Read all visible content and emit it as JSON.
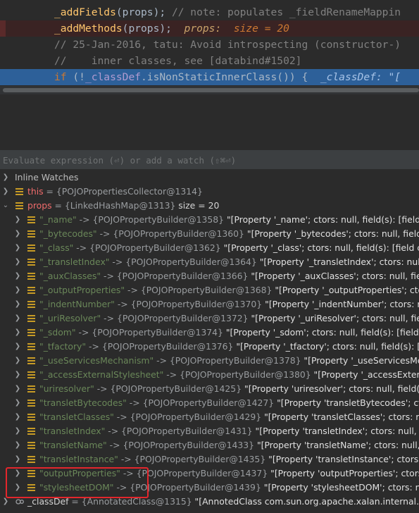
{
  "editor": {
    "lines": [
      {
        "kind": "normal",
        "parts": [
          {
            "cls": "c-method",
            "t": "_addFields"
          },
          {
            "cls": "c-text",
            "t": "(props); "
          },
          {
            "cls": "c-comment",
            "t": "// note: populates _fieldRenameMappin"
          }
        ]
      },
      {
        "kind": "bp",
        "parts": [
          {
            "cls": "c-method",
            "t": "_addMethods"
          },
          {
            "cls": "c-text",
            "t": "(props);  "
          },
          {
            "cls": "c-inline",
            "t": "props:  "
          },
          {
            "cls": "c-inline-v",
            "t": "size = 20"
          }
        ]
      },
      {
        "kind": "normal",
        "parts": [
          {
            "cls": "c-comment",
            "t": "// 25-Jan-2016, tatu: Avoid introspecting (constructor-)"
          }
        ]
      },
      {
        "kind": "normal",
        "parts": [
          {
            "cls": "c-comment",
            "t": "//    inner classes, see [databind#1502]"
          }
        ]
      },
      {
        "kind": "exec",
        "parts": [
          {
            "cls": "c-kw",
            "t": "if "
          },
          {
            "cls": "c-text",
            "t": "(!"
          },
          {
            "cls": "c-field",
            "t": "_classDef"
          },
          {
            "cls": "c-text",
            "t": ".isNonStaticInnerClass()) {  "
          },
          {
            "cls": "c-inline",
            "t": "_classDef: \"["
          }
        ]
      }
    ]
  },
  "eval": {
    "placeholder": "Evaluate expression (⏎) or add a watch (⇧⌘⏎)"
  },
  "tree": {
    "inline_watches": "Inline Watches",
    "this_row": {
      "name": "this",
      "eq": " = ",
      "value": "{POJOPropertiesCollector@1314}"
    },
    "props_row": {
      "name": "props",
      "eq": " = ",
      "value": "{LinkedHashMap@1313}",
      "size": "  size = 20"
    },
    "entries": [
      {
        "key": "\"_name\"",
        "ref": "{POJOPropertyBuilder@1358}",
        "val": "\"[Property '_name'; ctors: null, field(s): [field c"
      },
      {
        "key": "\"_bytecodes\"",
        "ref": "{POJOPropertyBuilder@1360}",
        "val": "\"[Property '_bytecodes'; ctors: null, field(s"
      },
      {
        "key": "\"_class\"",
        "ref": "{POJOPropertyBuilder@1362}",
        "val": "\"[Property '_class'; ctors: null, field(s): [field co"
      },
      {
        "key": "\"_transletIndex\"",
        "ref": "{POJOPropertyBuilder@1364}",
        "val": "\"[Property '_transletIndex'; ctors: null,"
      },
      {
        "key": "\"_auxClasses\"",
        "ref": "{POJOPropertyBuilder@1366}",
        "val": "\"[Property '_auxClasses'; ctors: null, fiel"
      },
      {
        "key": "\"_outputProperties\"",
        "ref": "{POJOPropertyBuilder@1368}",
        "val": "\"[Property '_outputProperties'; ctors"
      },
      {
        "key": "\"_indentNumber\"",
        "ref": "{POJOPropertyBuilder@1370}",
        "val": "\"[Property '_indentNumber'; ctors: nu"
      },
      {
        "key": "\"_uriResolver\"",
        "ref": "{POJOPropertyBuilder@1372}",
        "val": "\"[Property '_uriResolver'; ctors: null, fiel"
      },
      {
        "key": "\"_sdom\"",
        "ref": "{POJOPropertyBuilder@1374}",
        "val": "\"[Property '_sdom'; ctors: null, field(s): [field co"
      },
      {
        "key": "\"_tfactory\"",
        "ref": "{POJOPropertyBuilder@1376}",
        "val": "\"[Property '_tfactory'; ctors: null, field(s): [fi"
      },
      {
        "key": "\"_useServicesMechanism\"",
        "ref": "{POJOPropertyBuilder@1378}",
        "val": "\"[Property '_useServicesMe"
      },
      {
        "key": "\"_accessExternalStylesheet\"",
        "ref": "{POJOPropertyBuilder@1380}",
        "val": "\"[Property '_accessExtern"
      },
      {
        "key": "\"uriresolver\"",
        "ref": "{POJOPropertyBuilder@1425}",
        "val": "\"[Property 'uriresolver'; ctors: null, field(s)"
      },
      {
        "key": "\"transletBytecodes\"",
        "ref": "{POJOPropertyBuilder@1427}",
        "val": "\"[Property 'transletBytecodes'; ctor"
      },
      {
        "key": "\"transletClasses\"",
        "ref": "{POJOPropertyBuilder@1429}",
        "val": "\"[Property 'transletClasses'; ctors: nu"
      },
      {
        "key": "\"transletIndex\"",
        "ref": "{POJOPropertyBuilder@1431}",
        "val": "\"[Property 'transletIndex'; ctors: null, fie"
      },
      {
        "key": "\"transletName\"",
        "ref": "{POJOPropertyBuilder@1433}",
        "val": "\"[Property 'transletName'; ctors: null, f"
      },
      {
        "key": "\"transletInstance\"",
        "ref": "{POJOPropertyBuilder@1435}",
        "val": "\"[Property 'transletInstance'; ctors: nu"
      },
      {
        "key": "\"outputProperties\"",
        "ref": "{POJOPropertyBuilder@1437}",
        "val": "\"[Property 'outputProperties'; ctors"
      },
      {
        "key": "\"stylesheetDOM\"",
        "ref": "{POJOPropertyBuilder@1439}",
        "val": "\"[Property 'stylesheetDOM'; ctors: nu"
      }
    ],
    "classdef_row": {
      "name": "_classDef",
      "eq": " = ",
      "value": "{AnnotatedClass@1315}",
      "desc": " \"[AnnotedClass com.sun.org.apache.xalan.internal.xsl"
    },
    "arrow_sep": " -> ",
    "colors": {
      "highlight_border": "#e3262c",
      "exec_line": "#2d6099",
      "field_icon": "#c79b25"
    }
  }
}
